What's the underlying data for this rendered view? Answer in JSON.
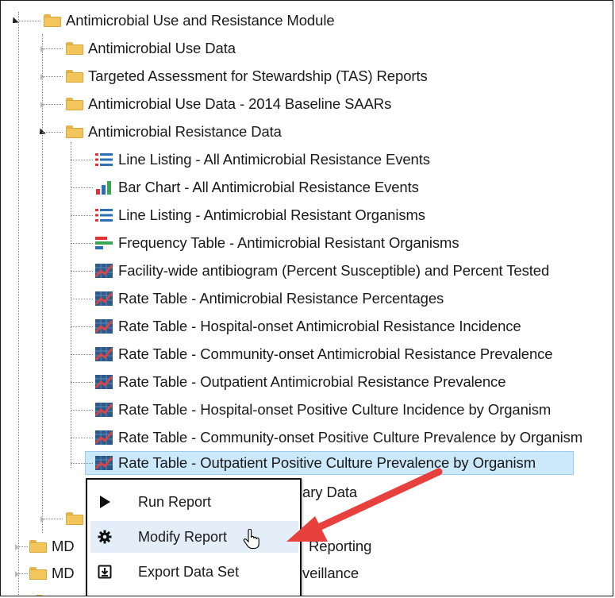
{
  "tree": {
    "root_label": "Antimicrobial Use and Resistance Module",
    "folders": [
      {
        "label": "Antimicrobial Use Data"
      },
      {
        "label": "Targeted Assessment for Stewardship (TAS) Reports"
      },
      {
        "label": "Antimicrobial Use Data - 2014 Baseline SAARs"
      },
      {
        "label": "Antimicrobial Resistance Data"
      }
    ],
    "reports": [
      {
        "label": "Line Listing - All Antimicrobial Resistance Events",
        "icon": "line-listing-icon"
      },
      {
        "label": "Bar Chart - All Antimicrobial Resistance Events",
        "icon": "bar-chart-icon"
      },
      {
        "label": "Line Listing - Antimicrobial Resistant Organisms",
        "icon": "line-listing-icon"
      },
      {
        "label": "Frequency Table - Antimicrobial Resistant Organisms",
        "icon": "frequency-table-icon"
      },
      {
        "label": "Facility-wide antibiogram (Percent Susceptible) and Percent Tested",
        "icon": "rate-table-icon"
      },
      {
        "label": "Rate Table - Antimicrobial Resistance Percentages",
        "icon": "rate-table-icon"
      },
      {
        "label": "Rate Table - Hospital-onset Antimicrobial Resistance Incidence",
        "icon": "rate-table-icon"
      },
      {
        "label": "Rate Table - Community-onset Antimicrobial Resistance Prevalence",
        "icon": "rate-table-icon"
      },
      {
        "label": "Rate Table - Outpatient Antimicrobial Resistance Prevalence",
        "icon": "rate-table-icon"
      },
      {
        "label": "Rate Table - Hospital-onset Positive Culture Incidence by Organism",
        "icon": "rate-table-icon"
      },
      {
        "label": "Rate Table - Community-onset Positive Culture Prevalence by Organism",
        "icon": "rate-table-icon"
      },
      {
        "label": "Rate Table - Outpatient Positive Culture Prevalence by Organism",
        "icon": "rate-table-icon",
        "selected": true
      }
    ],
    "partial_after_menu": {
      "summary_tail": "ary Data",
      "mdro_prefix_1": "MD",
      "mdro_tail_1": "Reporting",
      "mdro_prefix_2": "MD",
      "mdro_tail_2": "veillance"
    }
  },
  "context_menu": {
    "items": [
      {
        "label": "Run Report",
        "icon": "play-icon"
      },
      {
        "label": "Modify Report",
        "icon": "gear-icon",
        "hovered": true
      },
      {
        "label": "Export Data Set",
        "icon": "export-icon"
      }
    ]
  },
  "colors": {
    "selection_bg": "#cce8fb",
    "arrow": "#e8403c",
    "folder": "#f3c65c"
  }
}
